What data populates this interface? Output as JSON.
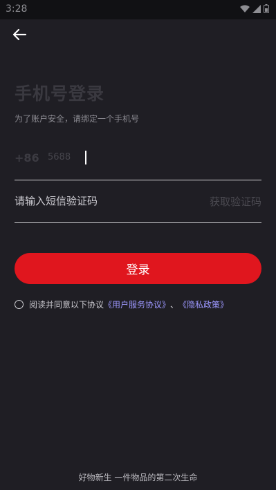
{
  "status_bar": {
    "time": "3:28"
  },
  "login": {
    "title": "手机号登录",
    "subtitle": "为了账户安全，请绑定一个手机号",
    "country_code": "+86",
    "phone_value": "5688",
    "code_placeholder": "请输入短信验证码",
    "get_code_label": "获取验证码",
    "submit_label": "登录"
  },
  "agreement": {
    "prefix": "阅读并同意以下协议",
    "user_agreement": "《用户服务协议》",
    "separator": "、",
    "privacy_policy": "《隐私政策》"
  },
  "footer": {
    "slogan": "好物新生 一件物品的第二次生命"
  },
  "colors": {
    "background": "#1f1e24",
    "accent": "#e0161e",
    "link": "#9d98ff"
  }
}
